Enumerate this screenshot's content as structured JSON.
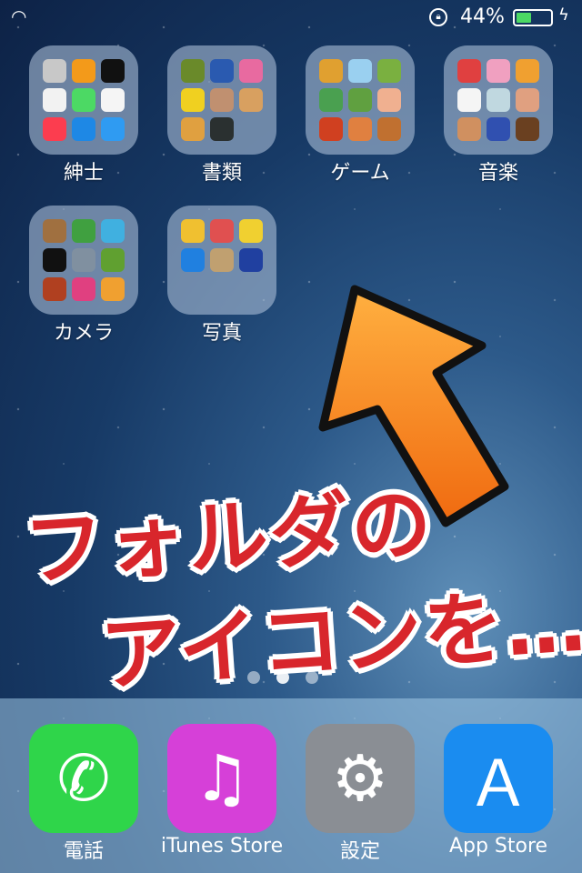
{
  "status": {
    "battery_text": "44%",
    "battery_level": 0.44
  },
  "folders": [
    {
      "label": "紳士",
      "icons": [
        "#c8c8c8",
        "#f39a1a",
        "#111111",
        "#f2f2f2",
        "#4cd964",
        "#f5f5f5",
        "#fc3d4f",
        "#1e88e5",
        "#2f9bf2"
      ]
    },
    {
      "label": "書類",
      "icons": [
        "#6a8a2a",
        "#2a5ab0",
        "#e86aa0",
        "#f0d020",
        "#c09070",
        "#d8a060",
        "#e0a040",
        "#2a3030"
      ]
    },
    {
      "label": "ゲーム",
      "icons": [
        "#e0a030",
        "#9ad0f0",
        "#7ab040",
        "#4aa050",
        "#60a040",
        "#f0b090",
        "#d04020",
        "#e08040",
        "#c07030"
      ]
    },
    {
      "label": "音楽",
      "icons": [
        "#e04040",
        "#f0a0c0",
        "#f0a030",
        "#f5f5f5",
        "#c0d8e0",
        "#e0a080",
        "#d09060",
        "#3050b0",
        "#6a4020"
      ]
    },
    {
      "label": "カメラ",
      "icons": [
        "#a07040",
        "#40a040",
        "#40b0e0",
        "#111111",
        "#8090a0",
        "#60a030",
        "#b04020",
        "#e04080",
        "#f0a030"
      ]
    },
    {
      "label": "写真",
      "icons": [
        "#f0c030",
        "#e05050",
        "#f0d030",
        "#2080e0",
        "#c0a070",
        "#2040a0"
      ]
    }
  ],
  "overlay": {
    "line1": "フォルダの",
    "line2": "アイコンを…"
  },
  "dock": [
    {
      "label": "電話",
      "color": "#2fd54a",
      "glyph": "✆"
    },
    {
      "label": "iTunes Store",
      "color": "#d640d8",
      "glyph": "♫"
    },
    {
      "label": "設定",
      "color": "#8a8e94",
      "glyph": "⚙"
    },
    {
      "label": "App Store",
      "color": "#1a8cf0",
      "glyph": "Ａ"
    }
  ]
}
